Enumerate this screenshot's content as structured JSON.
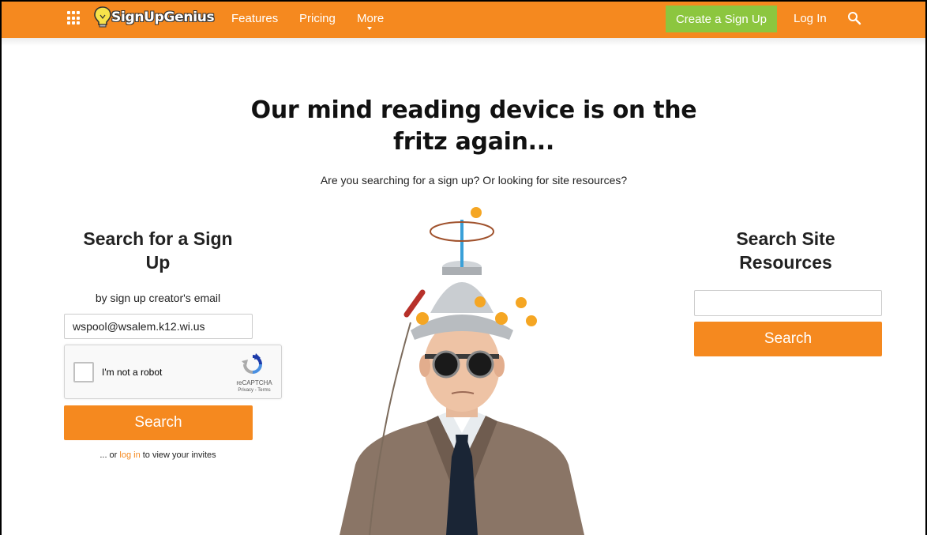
{
  "nav": {
    "logo_text": "SignUpGenius",
    "features": "Features",
    "pricing": "Pricing",
    "more": "More",
    "create": "Create a Sign Up",
    "login": "Log In"
  },
  "colors": {
    "brand_orange": "#f5891f",
    "create_green": "#8cc63f",
    "link_orange": "#f5891f"
  },
  "icons": {
    "apps": "apps-grid-icon",
    "logo": "lightbulb-icon",
    "search": "search-icon",
    "caret": "chevron-down-icon",
    "captcha": "recaptcha-icon"
  },
  "hero": {
    "headline": "Our mind reading device is on the fritz again...",
    "subhead": "Are you searching for a sign up? Or looking for site resources?"
  },
  "left": {
    "title": "Search for a Sign Up",
    "subtitle": "by sign up creator's email",
    "email_value": "wspool@wsalem.k12.wi.us",
    "captcha_label": "I'm not a robot",
    "captcha_brand": "reCAPTCHA",
    "captcha_links": "Privacy - Terms",
    "search_button": "Search",
    "invite_prefix": "... or ",
    "invite_link": "log in",
    "invite_suffix": " to view your invites"
  },
  "right": {
    "title": "Search Site Resources",
    "input_value": "",
    "search_button": "Search"
  }
}
